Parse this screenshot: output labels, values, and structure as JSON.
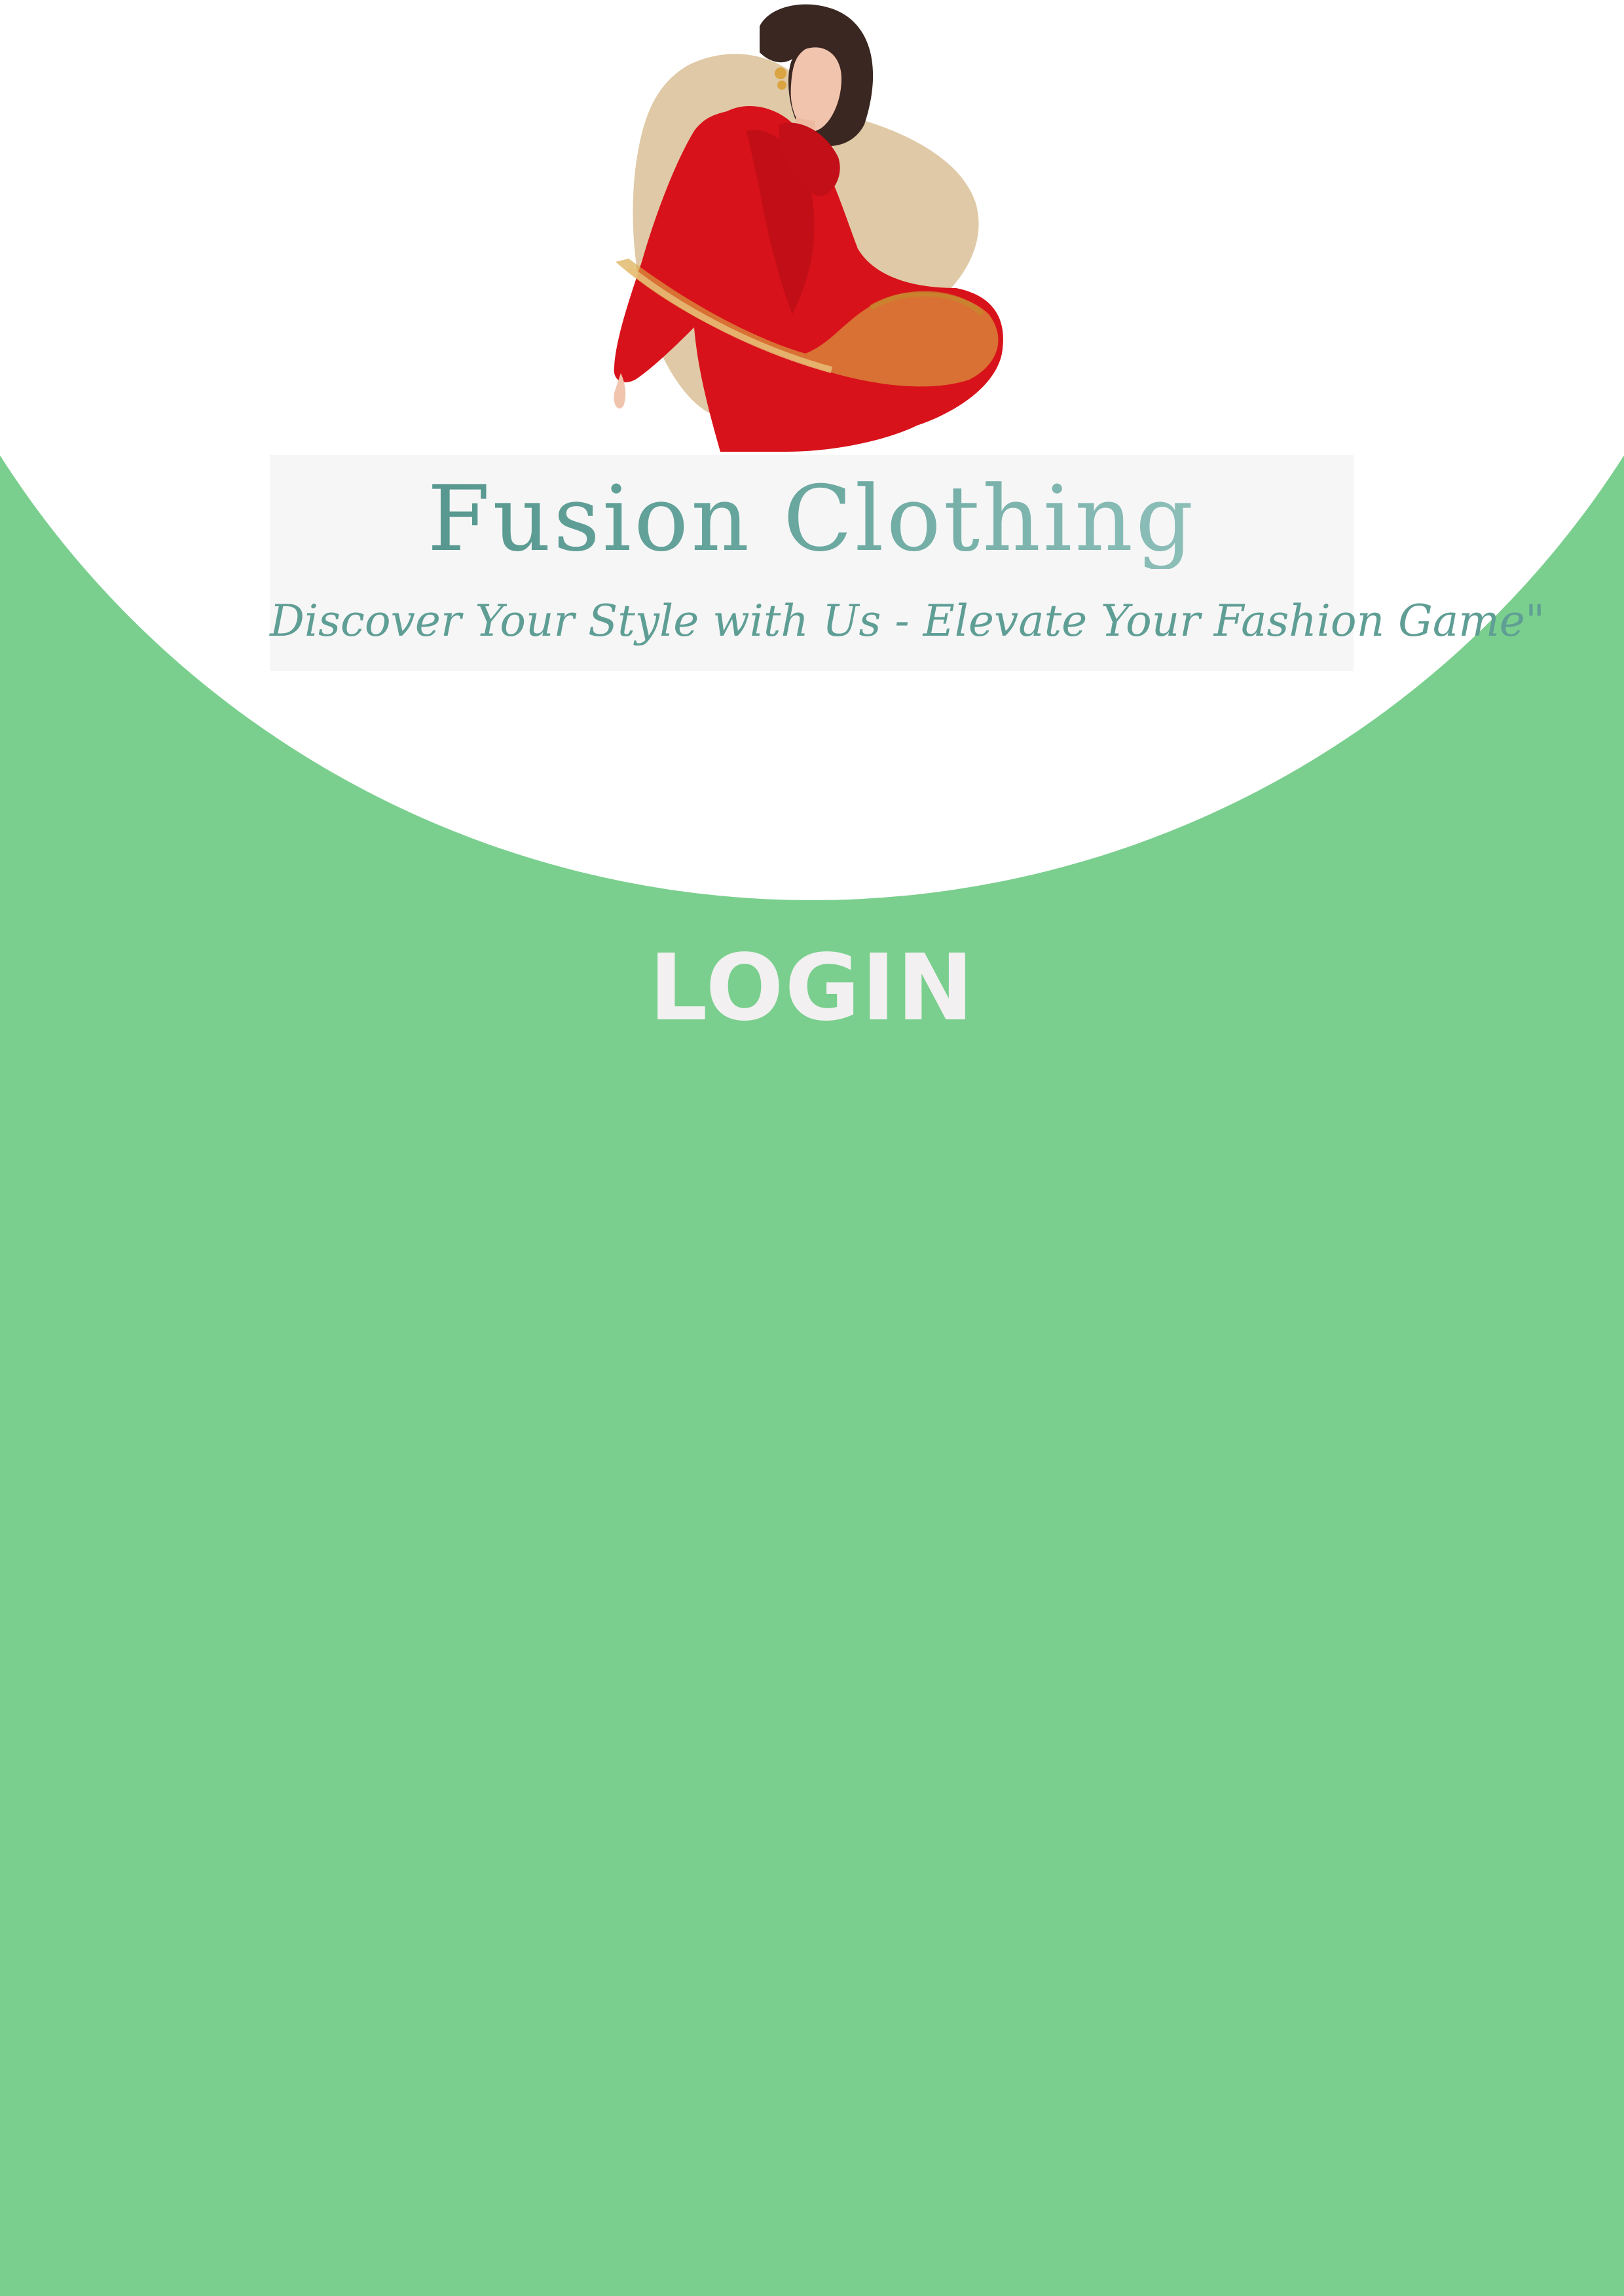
{
  "brand": {
    "name": "Fusion Clothing",
    "tagline": "Discover Your Style with Us - Elevate Your Fashion Game\""
  },
  "login": {
    "title": "LOGIN"
  },
  "colors": {
    "background": "#7acf8e",
    "hero": "#ffffff",
    "dress": "#d8121a",
    "accent_gold": "#d9a441",
    "blob": "#e0c9a6",
    "brand_text": "#6aa8a0"
  },
  "hero": {
    "image": "woman-in-red-dress-illustration"
  }
}
